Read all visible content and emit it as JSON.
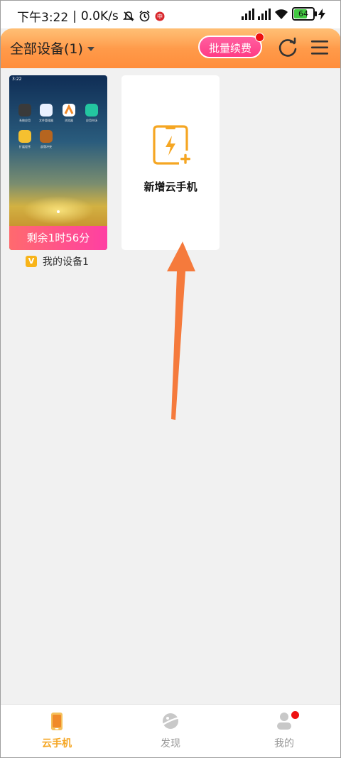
{
  "status_bar": {
    "time": "下午3:22",
    "speed": "0.0K/s",
    "battery": "64"
  },
  "header": {
    "title": "全部设备(1)",
    "renew_button": "批量续费"
  },
  "device": {
    "screen_time": "3:22",
    "apps": [
      "系统应用",
      "文件管理器",
      "浏览器",
      "应用市场",
      "扩展程序",
      "部落冲突"
    ],
    "time_left": "剩余1时56分",
    "badge": "V",
    "name": "我的设备1"
  },
  "add_card": {
    "label": "新增云手机"
  },
  "bottom_nav": {
    "items": [
      {
        "label": "云手机"
      },
      {
        "label": "发现"
      },
      {
        "label": "我的"
      }
    ]
  },
  "colors": {
    "header": "#ff9a48",
    "accent": "#f5a623",
    "renew": "#ff4a90",
    "arrow": "#f57a3c"
  }
}
